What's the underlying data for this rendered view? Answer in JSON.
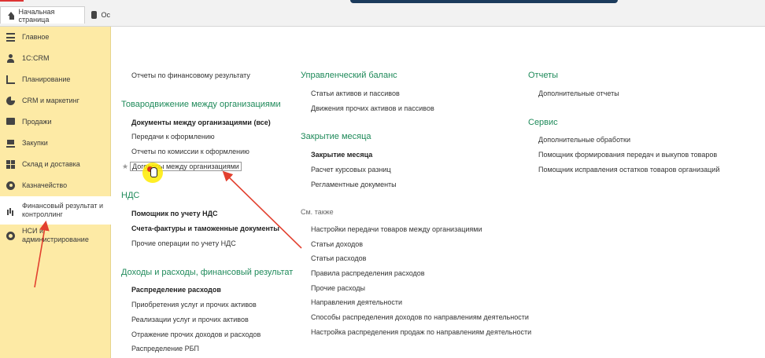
{
  "tabs": {
    "home_label": "Начальная страница",
    "second_label": "Ос"
  },
  "sidebar": {
    "items": [
      {
        "label": "Главное"
      },
      {
        "label": "1С:CRM"
      },
      {
        "label": "Планирование"
      },
      {
        "label": "CRM и маркетинг"
      },
      {
        "label": "Продажи"
      },
      {
        "label": "Закупки"
      },
      {
        "label": "Склад и доставка"
      },
      {
        "label": "Казначейство"
      },
      {
        "label": "Финансовый результат и контроллинг"
      },
      {
        "label": "НСИ и администрирование"
      }
    ]
  },
  "col1": {
    "top_link": "Отчеты по финансовому результату",
    "section1": {
      "title": "Товародвижение между организациями",
      "links": [
        "Документы между организациями (все)",
        "Передачи к оформлению",
        "Отчеты по комиссии к оформлению",
        "Договоры между организациями"
      ]
    },
    "section2": {
      "title": "НДС",
      "links": [
        "Помощник по учету НДС",
        "Счета-фактуры и таможенные документы",
        "Прочие операции по учету НДС"
      ]
    },
    "section3": {
      "title": "Доходы и расходы, финансовый результат",
      "links": [
        "Распределение расходов",
        "Приобретения услуг и прочих активов",
        "Реализации услуг и прочих активов",
        "Отражение прочих доходов и расходов",
        "Распределение РБП"
      ]
    }
  },
  "col2": {
    "section1": {
      "title": "Управленческий баланс",
      "links": [
        "Статьи активов и пассивов",
        "Движения прочих активов и пассивов"
      ]
    },
    "section2": {
      "title": "Закрытие месяца",
      "links": [
        "Закрытие месяца",
        "Расчет курсовых разниц",
        "Регламентные документы"
      ]
    },
    "see_also": {
      "title": "См. также",
      "links": [
        "Настройки передачи товаров между организациями",
        "Статьи доходов",
        "Статьи расходов",
        "Правила распределения расходов",
        "Прочие расходы",
        "Направления деятельности",
        "Способы распределения доходов по направлениям деятельности",
        "Настройка распределения продаж по направлениям деятельности"
      ]
    }
  },
  "col3": {
    "section1": {
      "title": "Отчеты",
      "links": [
        "Дополнительные отчеты"
      ]
    },
    "section2": {
      "title": "Сервис",
      "links": [
        "Дополнительные обработки",
        "Помощник формирования передач и выкупов товаров",
        "Помощник исправления остатков товаров организаций"
      ]
    }
  },
  "colors": {
    "sidebar_bg": "#fdeaa5",
    "heading_green": "#1f8a5a",
    "annotation_arrow": "#e2402f",
    "cursor_highlight": "#ffeb00"
  },
  "icons": [
    "home-icon",
    "document-icon",
    "menu-lines-icon",
    "person-icon",
    "chart-icon",
    "pie-icon",
    "bag-icon",
    "cart-icon",
    "warehouse-icon",
    "coin-icon",
    "bar-chart-icon",
    "gear-icon",
    "star-icon"
  ]
}
